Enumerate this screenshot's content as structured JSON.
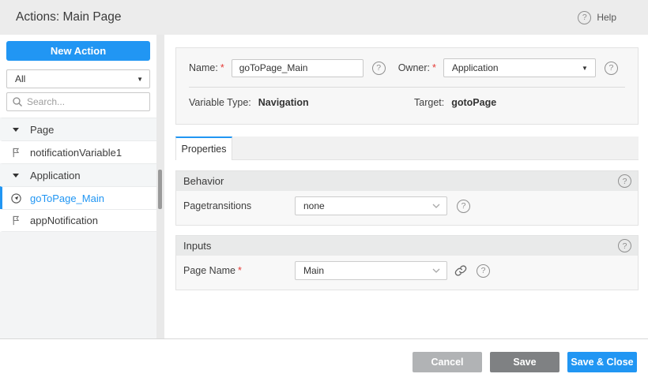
{
  "header": {
    "title": "Actions: Main Page",
    "help_label": "Help"
  },
  "ui": {
    "required_marker": "*",
    "help_glyph": "?",
    "select_caret": "▼"
  },
  "sidebar": {
    "new_action_label": "New Action",
    "filter_value": "All",
    "search_placeholder": "Search...",
    "tree": [
      {
        "type": "group",
        "label": "Page"
      },
      {
        "type": "item",
        "label": "notificationVariable1",
        "icon": "flag-icon",
        "selected": false
      },
      {
        "type": "group",
        "label": "Application"
      },
      {
        "type": "item",
        "label": "goToPage_Main",
        "icon": "navigation-icon",
        "selected": true
      },
      {
        "type": "item",
        "label": "appNotification",
        "icon": "flag-icon",
        "selected": false
      }
    ]
  },
  "form": {
    "name_label": "Name:",
    "name_value": "goToPage_Main",
    "owner_label": "Owner:",
    "owner_value": "Application",
    "variable_type_label": "Variable Type:",
    "variable_type_value": "Navigation",
    "target_label": "Target:",
    "target_value": "gotoPage"
  },
  "tabs": [
    {
      "label": "Properties",
      "active": true
    }
  ],
  "sections": {
    "behavior": {
      "title": "Behavior",
      "rows": [
        {
          "label": "Pagetransitions",
          "value": "none",
          "required": false
        }
      ]
    },
    "inputs": {
      "title": "Inputs",
      "rows": [
        {
          "label": "Page Name",
          "value": "Main",
          "required": true,
          "has_link": true
        }
      ]
    }
  },
  "footer": {
    "cancel_label": "Cancel",
    "save_label": "Save",
    "save_close_label": "Save & Close"
  },
  "colors": {
    "accent": "#2196f3",
    "required": "#e53935",
    "header_bg": "#ececec",
    "section_header_bg": "#e9eaea",
    "cancel_gray": "#b1b3b5",
    "save_gray": "#7f8183"
  }
}
